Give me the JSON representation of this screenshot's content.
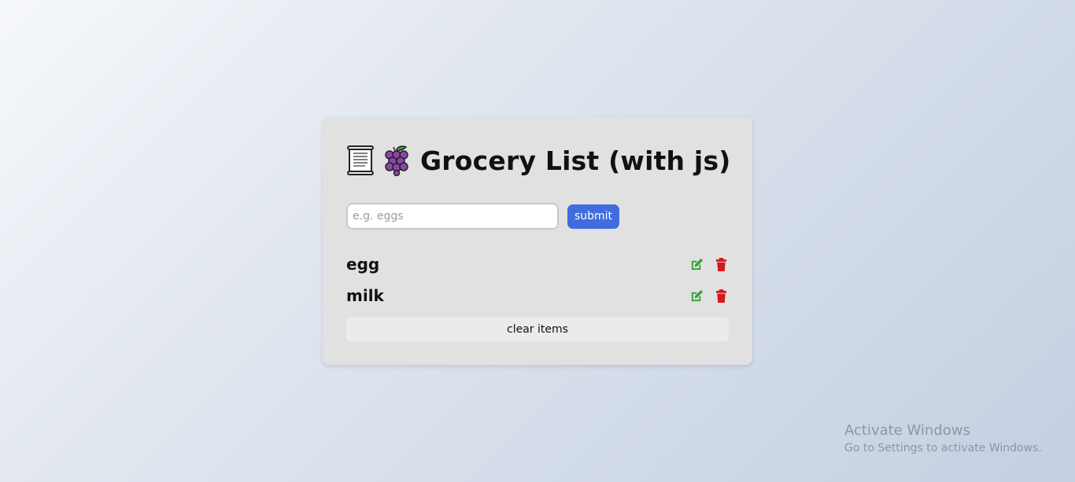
{
  "header": {
    "title": "Grocery List (with js)",
    "icons": [
      "scroll-icon",
      "grapes-icon"
    ]
  },
  "form": {
    "placeholder": "e.g. eggs",
    "value": "",
    "submit_label": "submit"
  },
  "items": [
    {
      "name": "egg"
    },
    {
      "name": "milk"
    }
  ],
  "actions": {
    "edit_icon": "edit-icon",
    "delete_icon": "trash-icon",
    "edit_color": "#2fa52f",
    "delete_color": "#d11a1a"
  },
  "clear_label": "clear items",
  "colors": {
    "accent": "#3f6ddd",
    "card": "#e1e1e1"
  },
  "watermark": {
    "title": "Activate Windows",
    "subtitle": "Go to Settings to activate Windows."
  }
}
